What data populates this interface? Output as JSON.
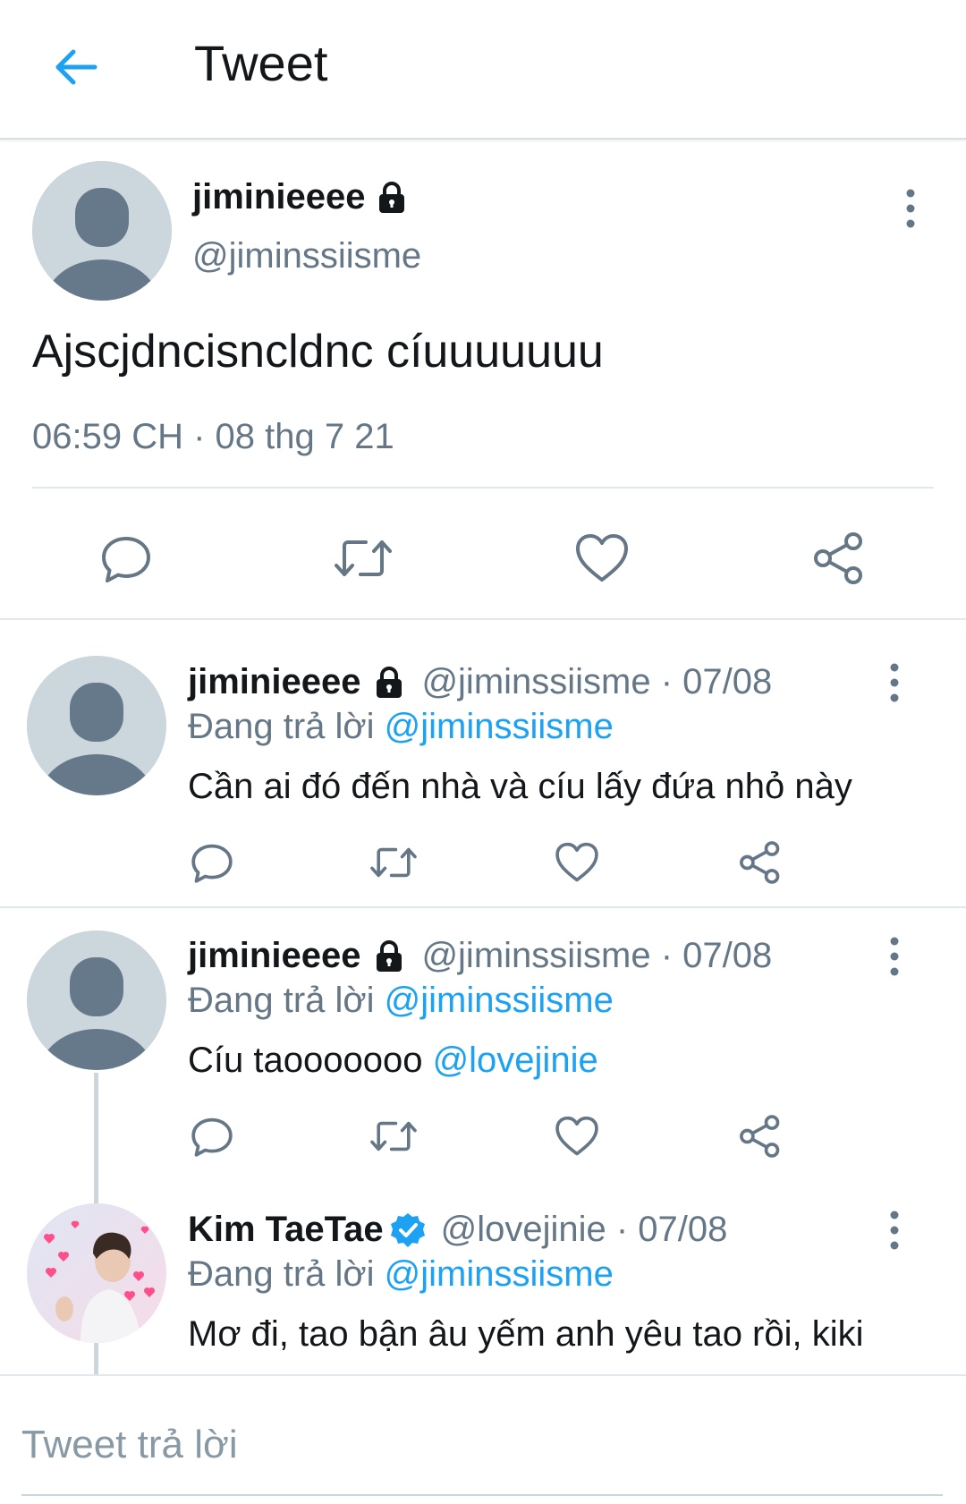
{
  "header": {
    "title": "Tweet"
  },
  "main_tweet": {
    "name": "jiminieeee",
    "handle": "@jiminssiisme",
    "text": "Ajscjdncisncldnc cíuuuuuuu",
    "timestamp": "06:59 CH · 08 thg 7 21"
  },
  "replies": [
    {
      "name": "jiminieeee",
      "handle_date": "@jiminssiisme · 07/08",
      "replying_prefix": "Đang trả lời ",
      "replying_to": "@jiminssiisme",
      "text": "Cần ai đó đến nhà và cíu lấy đứa nhỏ này"
    },
    {
      "name": "jiminieeee",
      "handle_date": "@jiminssiisme · 07/08",
      "replying_prefix": "Đang trả lời ",
      "replying_to": "@jiminssiisme",
      "text": "Cíu taooooooo ",
      "text_mention": "@lovejinie"
    },
    {
      "name": "Kim TaeTae",
      "handle_date": "@lovejinie · 07/08",
      "replying_prefix": "Đang trả lời ",
      "replying_to": "@jiminssiisme",
      "text": "Mơ đi, tao bận âu yếm anh yêu tao rồi, kiki"
    }
  ],
  "compose": {
    "placeholder": "Tweet trả lời"
  },
  "colors": {
    "accent": "#1da1f2",
    "muted": "#657786",
    "text": "#14171a",
    "divider": "#e1e8ed"
  },
  "icons": [
    "back-arrow-icon",
    "lock-icon",
    "more-vertical-icon",
    "reply-icon",
    "retweet-icon",
    "like-icon",
    "share-icon",
    "verified-badge-icon"
  ]
}
